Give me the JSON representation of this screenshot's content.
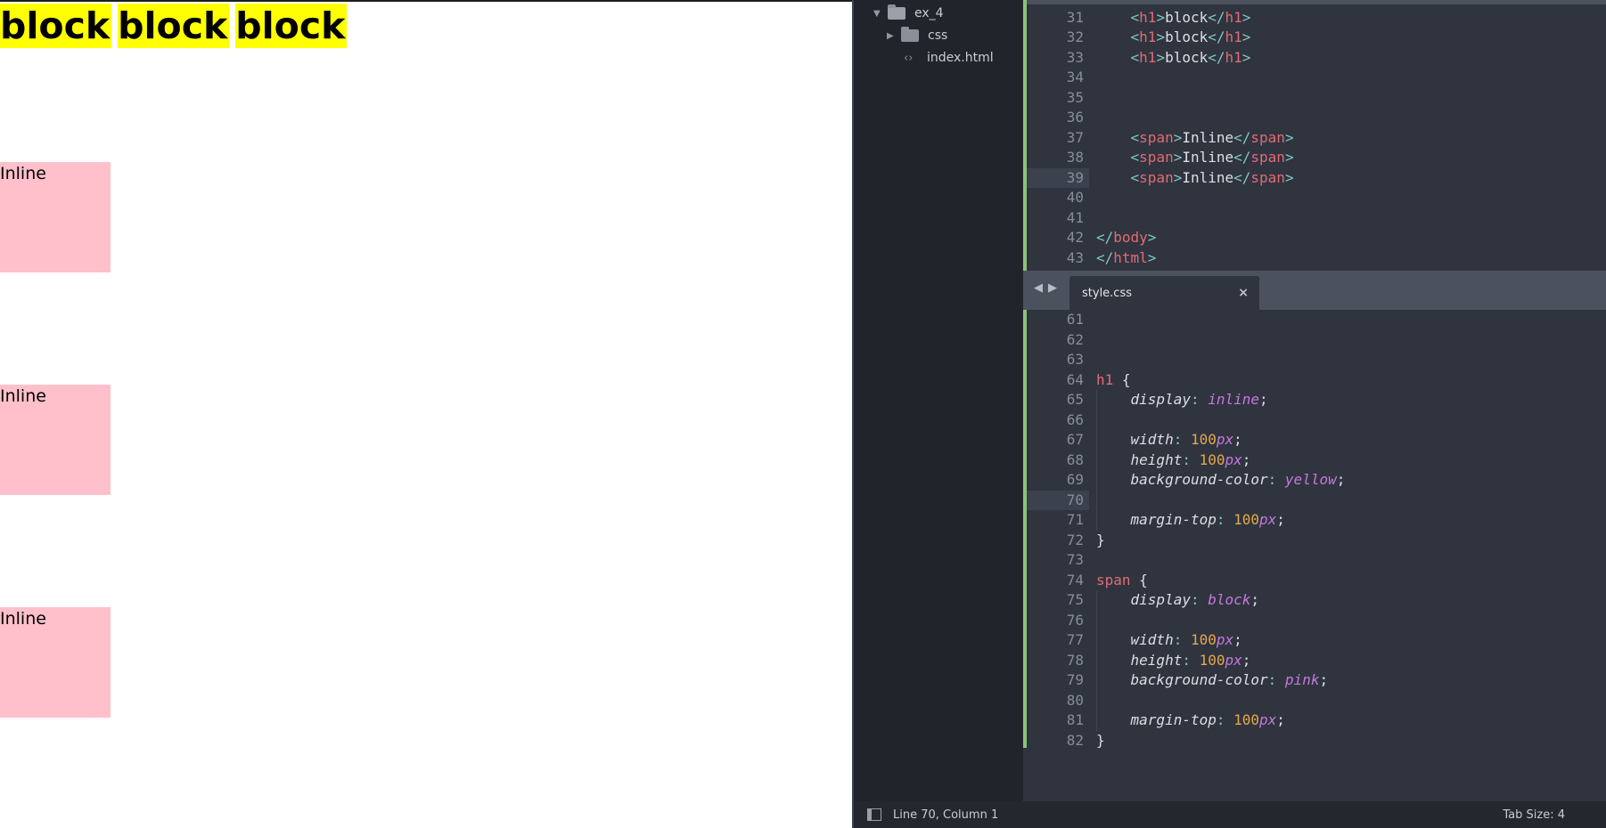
{
  "preview": {
    "headings": [
      "block",
      "block",
      "block"
    ],
    "spans": [
      "Inline",
      "Inline",
      "Inline"
    ]
  },
  "sidebar": {
    "project_folder": "ex_4",
    "css_folder": "css",
    "file": "index.html"
  },
  "html_pane": {
    "lines": [
      {
        "n": "31",
        "code": "h1block"
      },
      {
        "n": "32",
        "code": "h1block"
      },
      {
        "n": "33",
        "code": "h1block"
      },
      {
        "n": "34",
        "code": ""
      },
      {
        "n": "35",
        "code": ""
      },
      {
        "n": "36",
        "code": ""
      },
      {
        "n": "37",
        "code": "spanInline"
      },
      {
        "n": "38",
        "code": "spanInline"
      },
      {
        "n": "39",
        "code": "spanInline"
      },
      {
        "n": "40",
        "code": ""
      },
      {
        "n": "41",
        "code": ""
      },
      {
        "n": "42",
        "code": "/body"
      },
      {
        "n": "43",
        "code": "/html"
      }
    ],
    "h1_tag": "h1",
    "h1_text": "block",
    "span_tag": "span",
    "span_text": "Inline",
    "body_close": "body",
    "html_close": "html"
  },
  "tab": {
    "label": "style.css",
    "close": "×"
  },
  "css_pane": {
    "line_numbers": [
      "61",
      "62",
      "63",
      "64",
      "65",
      "66",
      "67",
      "68",
      "69",
      "70",
      "71",
      "72",
      "73",
      "74",
      "75",
      "76",
      "77",
      "78",
      "79",
      "80",
      "81",
      "82"
    ],
    "h1_selector": "h1",
    "span_selector": "span",
    "open_brace": "{",
    "close_brace": "}",
    "display_prop": "display",
    "width_prop": "width",
    "height_prop": "height",
    "bg_prop": "background-color",
    "margin_prop": "margin-top",
    "inline_val": "inline",
    "block_val": "block",
    "yellow_val": "yellow",
    "pink_val": "pink",
    "num_100": "100",
    "unit_px": "px"
  },
  "status": {
    "position": "Line 70, Column 1",
    "tab_size": "Tab Size: 4"
  },
  "colors": {
    "h1_bg": "#ffff00",
    "span_bg": "#ffc0cb",
    "editor_bg": "#2f343f",
    "sidebar_bg": "#21252b",
    "tag": "#e06c75",
    "punct": "#7fc6c2",
    "value": "#c678dd",
    "number": "#e5a84b",
    "git_gutter": "#8fc27a"
  },
  "icons": {
    "folder": "folder-icon",
    "open_folder": "folder-open-icon",
    "file": "code-file-icon",
    "panel": "panel-toggle-icon"
  }
}
